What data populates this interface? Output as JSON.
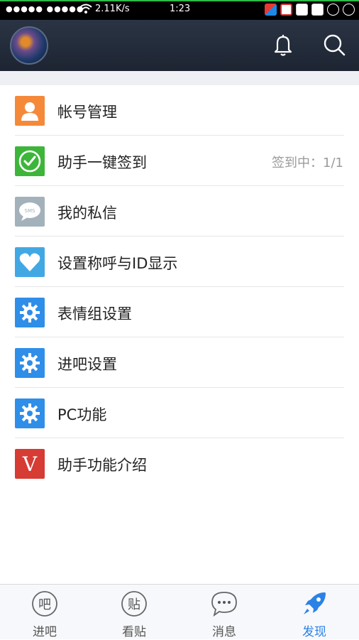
{
  "status_bar": {
    "signal": "●●●●● ●●●●●",
    "speed": "2.11K/s",
    "time": "1:23"
  },
  "nav": {
    "avatar": "avatar",
    "bell_icon": "bell-icon",
    "search_icon": "search-icon"
  },
  "menu": [
    {
      "label": "帐号管理",
      "icon": "person-icon",
      "color": "#f5893a",
      "aside": ""
    },
    {
      "label": "助手一键签到",
      "icon": "check-icon",
      "color": "#3db53a",
      "aside": "签到中：1/1"
    },
    {
      "label": "我的私信",
      "icon": "sms-icon",
      "color": "#a3b1bb",
      "aside": ""
    },
    {
      "label": "设置称呼与ID显示",
      "icon": "heart-icon",
      "color": "#42a8e4",
      "aside": ""
    },
    {
      "label": "表情组设置",
      "icon": "gear-icon",
      "color": "#2f8ee8",
      "aside": ""
    },
    {
      "label": "进吧设置",
      "icon": "gear-icon",
      "color": "#2f8ee8",
      "aside": ""
    },
    {
      "label": "PC功能",
      "icon": "gear-icon",
      "color": "#2f8ee8",
      "aside": ""
    },
    {
      "label": "助手功能介绍",
      "icon": "v-logo-icon",
      "color": "#d63b34",
      "aside": "",
      "glyph": "V"
    }
  ],
  "sms_glyph": "SMS",
  "tabs": [
    {
      "label": "进吧",
      "glyph": "吧",
      "active": false
    },
    {
      "label": "看贴",
      "glyph": "贴",
      "active": false
    },
    {
      "label": "消息",
      "glyph": "•••",
      "active": false
    },
    {
      "label": "发现",
      "glyph": "",
      "active": true
    }
  ],
  "colors": {
    "nav_bg": "#232c3b",
    "accent": "#2b82e6"
  }
}
